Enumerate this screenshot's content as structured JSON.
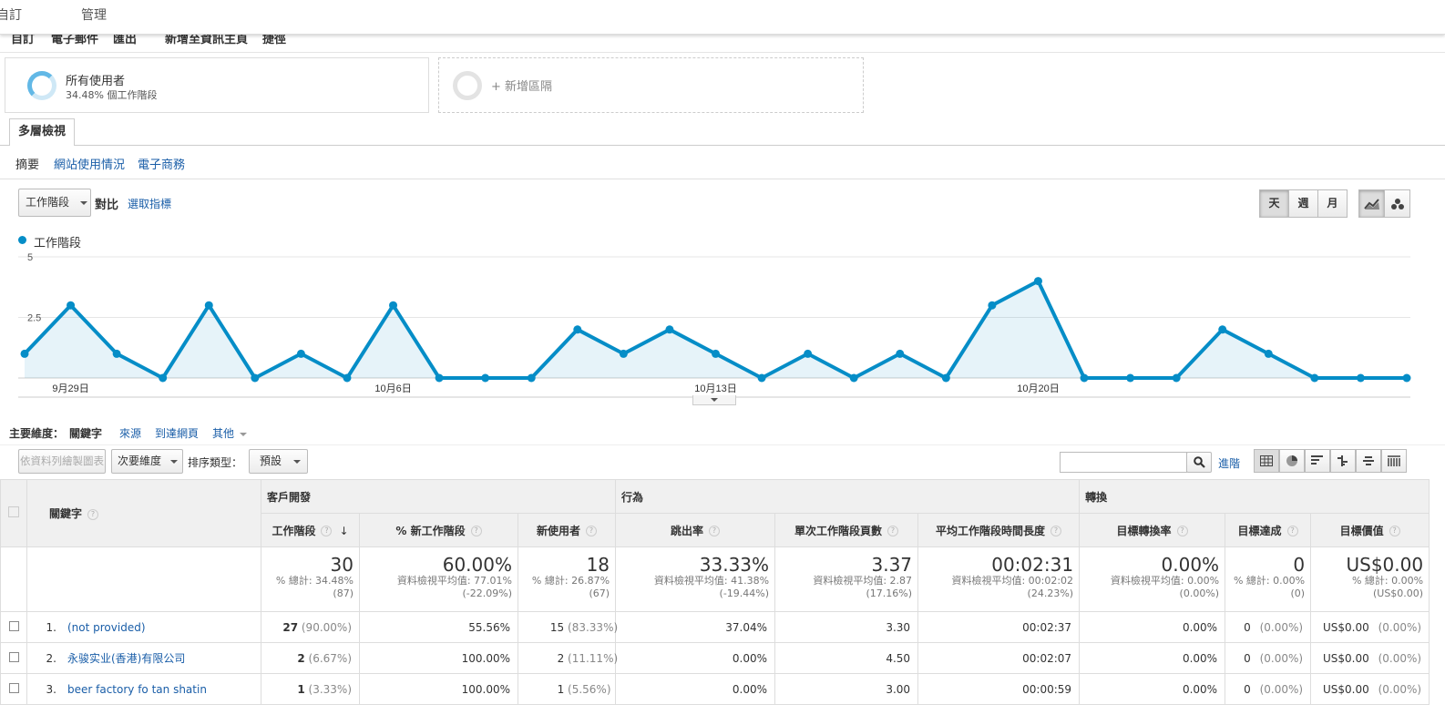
{
  "topbar": {
    "item1": "自訂",
    "item2": "管理"
  },
  "subbar": {
    "items": [
      "自訂",
      "電子郵件",
      "匯出",
      "新增至資訊主頁",
      "捷徑"
    ]
  },
  "segments": {
    "all_users": {
      "title": "所有使用者",
      "subtitle": "34.48% 個工作階段"
    },
    "add_segment": {
      "label": "+ 新增區隔"
    }
  },
  "tab": {
    "label": "多層檢視"
  },
  "subtabs": {
    "summary": "摘要",
    "site_usage": "網站使用情況",
    "ecommerce": "電子商務"
  },
  "chart_controls": {
    "metric_select": "工作階段",
    "vs": "對比",
    "select_metric": "選取指標",
    "day": "天",
    "week": "週",
    "month": "月"
  },
  "chart_data": {
    "type": "line",
    "series": [
      {
        "name": "工作階段",
        "values": [
          1,
          3,
          1,
          0,
          3,
          0,
          1,
          0,
          3,
          0,
          0,
          0,
          2,
          1,
          2,
          1,
          0,
          1,
          0,
          1,
          0,
          3,
          4,
          0,
          0,
          0,
          2,
          1,
          0,
          0,
          0
        ]
      }
    ],
    "x_tick_labels": [
      "9月29日",
      "10月6日",
      "10月13日",
      "10月20日"
    ],
    "y_tick_labels": [
      "5",
      "2.5"
    ],
    "ylim": [
      0,
      5
    ],
    "grid": true,
    "legend": "top-left",
    "color": "#058dc7"
  },
  "dimensions": {
    "label": "主要維度：",
    "keyword": "關鍵字",
    "source": "來源",
    "landing_page": "到達網頁",
    "other": "其他"
  },
  "toolbar": {
    "plot_rows": "依資料列繪製圖表",
    "secondary_dim": "次要維度",
    "sort_type_label": "排序類型：",
    "sort_value": "預設",
    "advanced": "進階",
    "search_placeholder": ""
  },
  "table": {
    "groups": {
      "acquisition": "客戶開發",
      "behavior": "行為",
      "conversion": "轉換"
    },
    "columns": {
      "keyword": "關鍵字",
      "sessions": "工作階段",
      "new_sessions_pct": "% 新工作階段",
      "new_users": "新使用者",
      "bounce_rate": "跳出率",
      "pages_per_session": "單次工作階段頁數",
      "avg_duration": "平均工作階段時間長度",
      "goal_conv_rate": "目標轉換率",
      "goal_completions": "目標達成",
      "goal_value": "目標價值"
    },
    "totals": {
      "sessions": {
        "big": "30",
        "l1": "% 總計: 34.48%",
        "l2": "(87)"
      },
      "new_sessions_pct": {
        "big": "60.00%",
        "l1": "資料檢視平均值: 77.01%",
        "l2": "(-22.09%)"
      },
      "new_users": {
        "big": "18",
        "l1": "% 總計: 26.87%",
        "l2": "(67)"
      },
      "bounce_rate": {
        "big": "33.33%",
        "l1": "資料檢視平均值: 41.38%",
        "l2": "(-19.44%)"
      },
      "pages_per_session": {
        "big": "3.37",
        "l1": "資料檢視平均值: 2.87",
        "l2": "(17.16%)"
      },
      "avg_duration": {
        "big": "00:02:31",
        "l1": "資料檢視平均值: 00:02:02",
        "l2": "(24.23%)"
      },
      "goal_conv_rate": {
        "big": "0.00%",
        "l1": "資料檢視平均值: 0.00%",
        "l2": "(0.00%)"
      },
      "goal_completions": {
        "big": "0",
        "l1": "% 總計: 0.00%",
        "l2": "(0)"
      },
      "goal_value": {
        "big": "US$0.00",
        "l1": "% 總計: 0.00%",
        "l2": "(US$0.00)"
      }
    },
    "rows": [
      {
        "num": "1.",
        "keyword": "(not provided)",
        "sessions": "27",
        "sessions_pct": "(90.00%)",
        "new_sessions_pct": "55.56%",
        "new_users": "15",
        "new_users_pct": "(83.33%)",
        "bounce_rate": "37.04%",
        "pages": "3.30",
        "duration": "00:02:37",
        "conv_rate": "0.00%",
        "completions": "0",
        "completions_pct": "(0.00%)",
        "value": "US$0.00",
        "value_pct": "(0.00%)"
      },
      {
        "num": "2.",
        "keyword": "永骏实业(香港)有限公司",
        "sessions": "2",
        "sessions_pct": "(6.67%)",
        "new_sessions_pct": "100.00%",
        "new_users": "2",
        "new_users_pct": "(11.11%)",
        "bounce_rate": "0.00%",
        "pages": "4.50",
        "duration": "00:02:07",
        "conv_rate": "0.00%",
        "completions": "0",
        "completions_pct": "(0.00%)",
        "value": "US$0.00",
        "value_pct": "(0.00%)"
      },
      {
        "num": "3.",
        "keyword": "beer factory fo tan shatin",
        "sessions": "1",
        "sessions_pct": "(3.33%)",
        "new_sessions_pct": "100.00%",
        "new_users": "1",
        "new_users_pct": "(5.56%)",
        "bounce_rate": "0.00%",
        "pages": "3.00",
        "duration": "00:00:59",
        "conv_rate": "0.00%",
        "completions": "0",
        "completions_pct": "(0.00%)",
        "value": "US$0.00",
        "value_pct": "(0.00%)"
      }
    ]
  }
}
